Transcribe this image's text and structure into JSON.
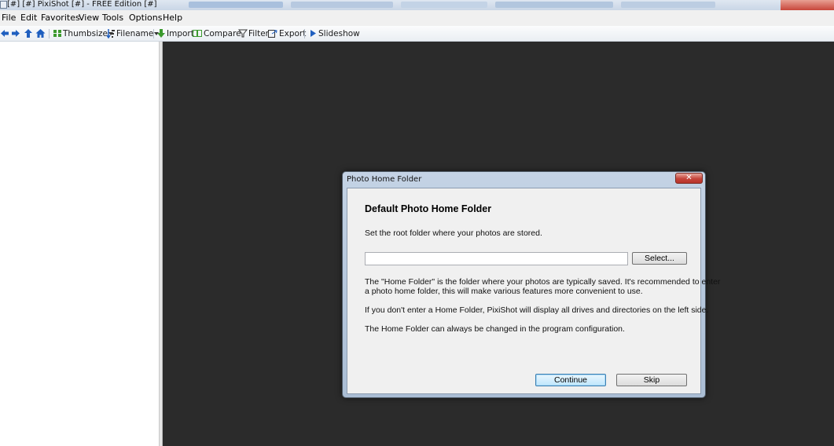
{
  "window": {
    "title": "[#] [#] PixiShot [#]  -  FREE Edition [#]"
  },
  "menu": {
    "items": [
      "File",
      "Edit",
      "Favorites",
      "View",
      "Tools",
      "Options",
      "Help"
    ]
  },
  "toolbar": {
    "thumbsize_label": "Thumbsize",
    "filename_label": "Filename",
    "import_label": "Import",
    "compare_label": "Compare",
    "filter_label": "Filter",
    "export_label": "Export",
    "slideshow_label": "Slideshow"
  },
  "dialog": {
    "title": "Photo Home Folder",
    "close_glyph": "✕",
    "heading": "Default Photo Home Folder",
    "instruction": "Set the root folder where your photos are stored.",
    "folder_value": "",
    "select_button": "Select...",
    "paragraph1_line1": "The \"Home Folder\" is the folder where your photos are typically saved. It's recommended to enter",
    "paragraph1_line2": "a photo home folder, this will make various features more convenient to use.",
    "paragraph2": "If you don't enter a Home Folder, PixiShot will display all drives and directories on the left side.",
    "paragraph3": "The Home Folder can always be changed in the program configuration.",
    "continue_button": "Continue",
    "skip_button": "Skip"
  },
  "colors": {
    "main_background": "#2b2b2b",
    "dialog_frame": "#b6c7dc",
    "close_button": "#c5443a",
    "toolbar_icon_blue": "#1f5fbf",
    "toolbar_icon_green": "#3c9a2e"
  }
}
